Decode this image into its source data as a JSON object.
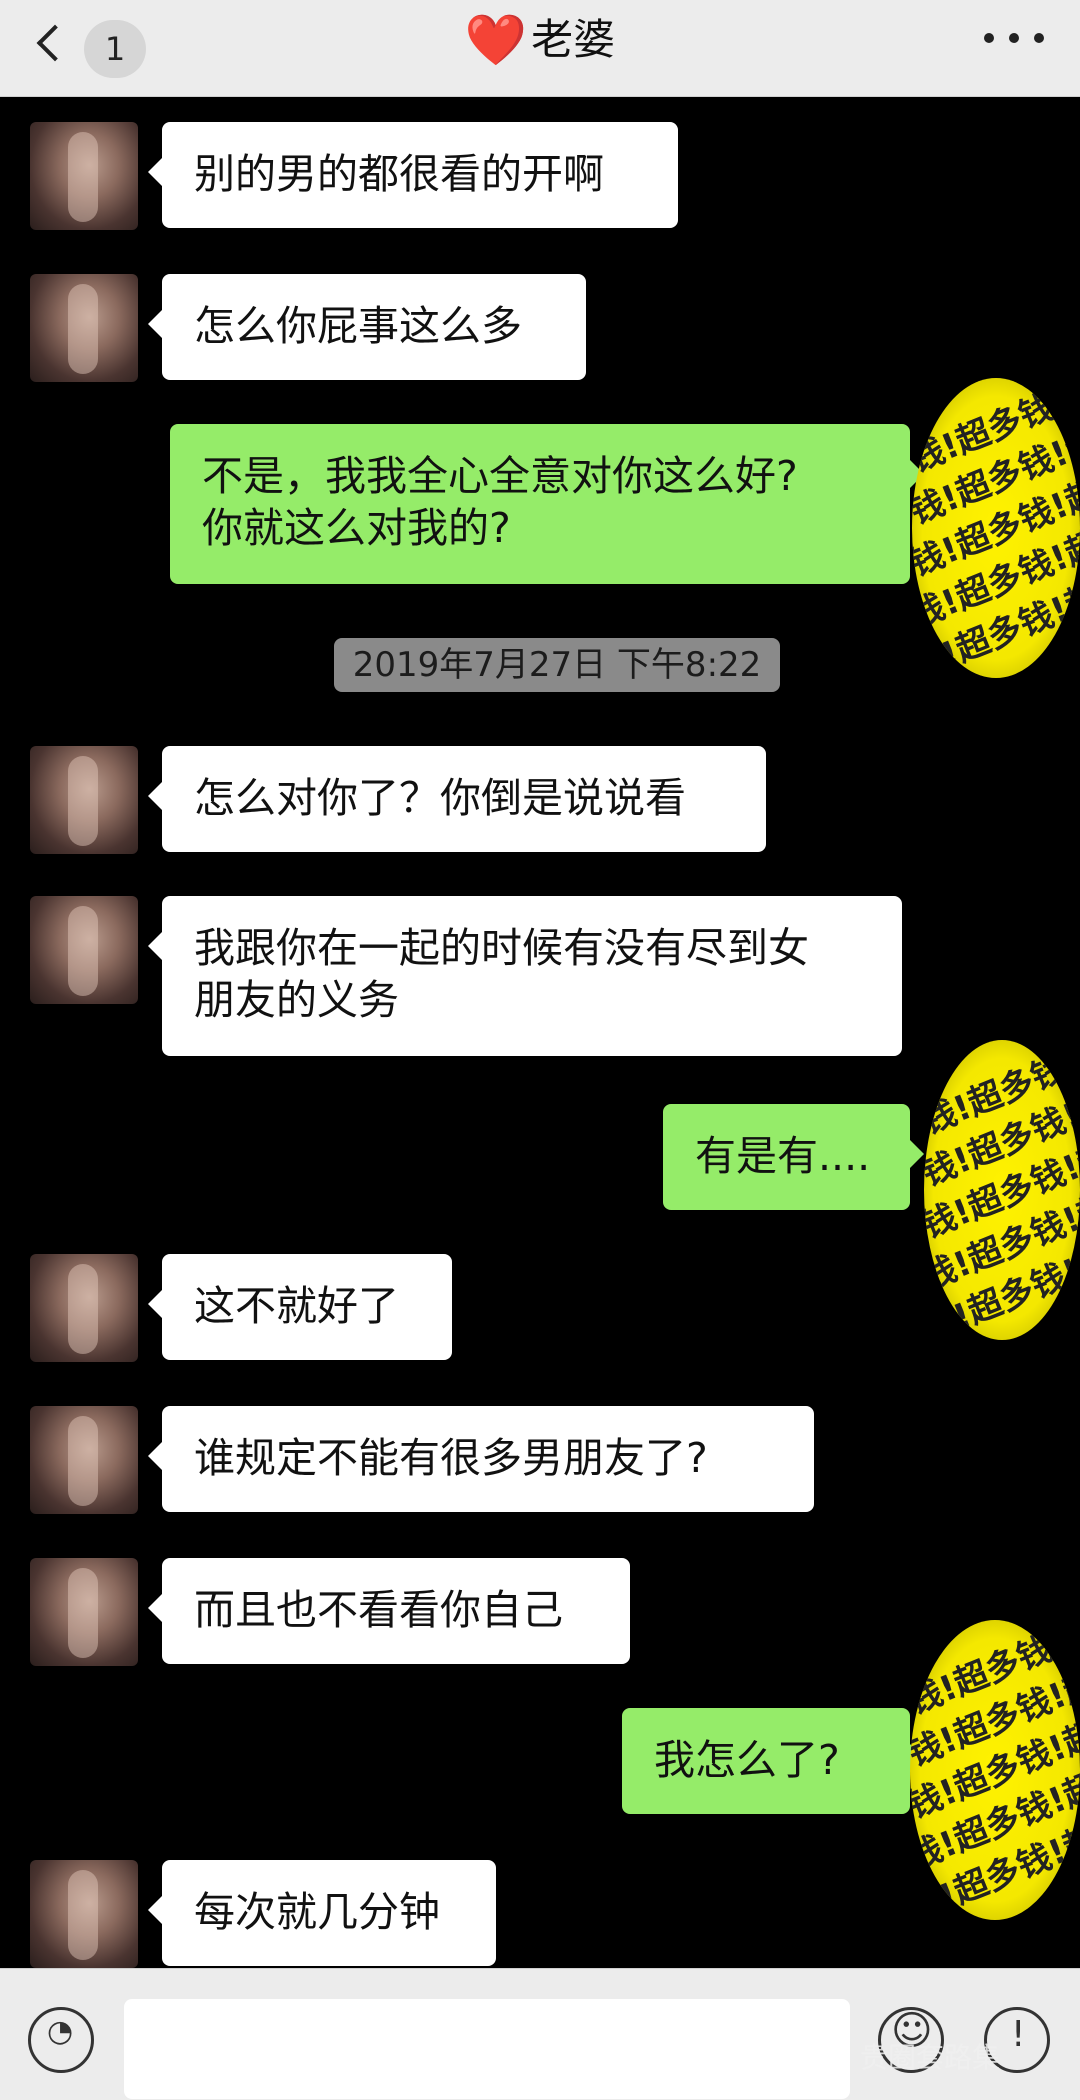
{
  "header": {
    "back_count": "1",
    "title_heart": "❤️",
    "title": "老婆"
  },
  "timestamp": "2019年7月27日 下午8:22",
  "messages": [
    {
      "side": "in",
      "text": "别的男的都很看的开啊"
    },
    {
      "side": "in",
      "text": "怎么你屁事这么多"
    },
    {
      "side": "out",
      "text": "不是，我我全心全意对你这么好?\n你就这么对我的?"
    },
    {
      "side": "in",
      "text": "怎么对你了？你倒是说说看"
    },
    {
      "side": "in",
      "text": "我跟你在一起的时候有没有尽到女\n朋友的义务"
    },
    {
      "side": "out",
      "text": "有是有...."
    },
    {
      "side": "in",
      "text": "这不就好了"
    },
    {
      "side": "in",
      "text": "谁规定不能有很多男朋友了?"
    },
    {
      "side": "in",
      "text": "而且也不看看你自己"
    },
    {
      "side": "out",
      "text": "我怎么了?"
    },
    {
      "side": "in",
      "text": "每次就几分钟"
    }
  ],
  "censor_text": "钱!超多钱!超多",
  "watermark": "贵圈套路集",
  "icons": {
    "back": "chevron-left-icon",
    "more": "more-dots-icon",
    "voice": "voice-icon",
    "emoji": "emoji-icon",
    "plus": "plus-icon"
  },
  "colors": {
    "incoming_bubble": "#ffffff",
    "outgoing_bubble": "#95ec69",
    "background": "#000000",
    "header": "#ececec"
  }
}
